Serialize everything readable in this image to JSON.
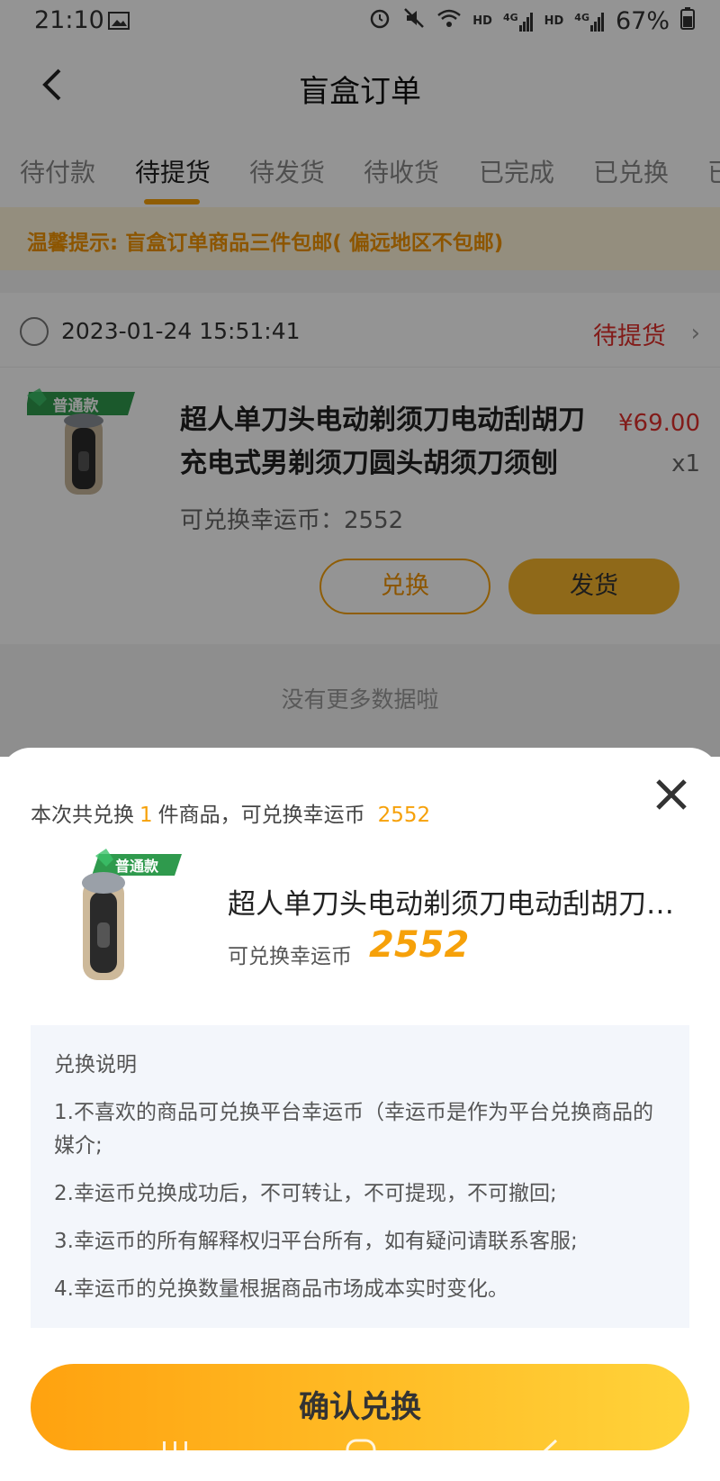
{
  "status_bar": {
    "time": "21:10",
    "battery": "67%",
    "icons": [
      "image-icon",
      "alarm-icon",
      "mute-icon",
      "wifi-icon",
      "signal-icon",
      "battery-icon"
    ],
    "signal_labels": [
      "HD",
      "4G",
      "HD",
      "4G"
    ]
  },
  "nav": {
    "title": "盲盒订单"
  },
  "tabs": [
    "待付款",
    "待提货",
    "待发货",
    "待收货",
    "已完成",
    "已兑换",
    "已"
  ],
  "active_tab": "待提货",
  "notice": "温馨提示: 盲盒订单商品三件包邮( 偏远地区不包邮)",
  "order": {
    "date": "2023-01-24 15:51:41",
    "status": "待提货",
    "product_name": "超人单刀头电动剃须刀电动刮胡刀充电式男剃须刀圆头胡须刀须刨",
    "price": "¥69.00",
    "quantity": "x1",
    "coins_label": "可兑换幸运币：2552",
    "badge": "普通款",
    "exchange_button": "兑换",
    "ship_button": "发货"
  },
  "no_more": "没有更多数据啦",
  "sheet": {
    "summary_prefix": "本次共兑换",
    "summary_count": "1",
    "summary_middle": "件商品，可兑换幸运币",
    "summary_coins": "2552",
    "product_name": "超人单刀头电动剃须刀电动刮胡刀…",
    "coins_label": "可兑换幸运币",
    "coins_value": "2552",
    "badge": "普通款",
    "rules_title": "兑换说明",
    "rules": [
      "1.不喜欢的商品可兑换平台幸运币（幸运币是作为平台兑换商品的媒介;",
      "2.幸运币兑换成功后，不可转让，不可提现，不可撤回;",
      "3.幸运币的所有解释权归平台所有，如有疑问请联系客服;",
      "4.幸运币的兑换数量根据商品市场成本实时变化。"
    ],
    "confirm_button": "确认兑换"
  },
  "colors": {
    "accent": "#f6a10a",
    "price_red": "#e0302b",
    "notice_bg": "#fff4d9"
  }
}
